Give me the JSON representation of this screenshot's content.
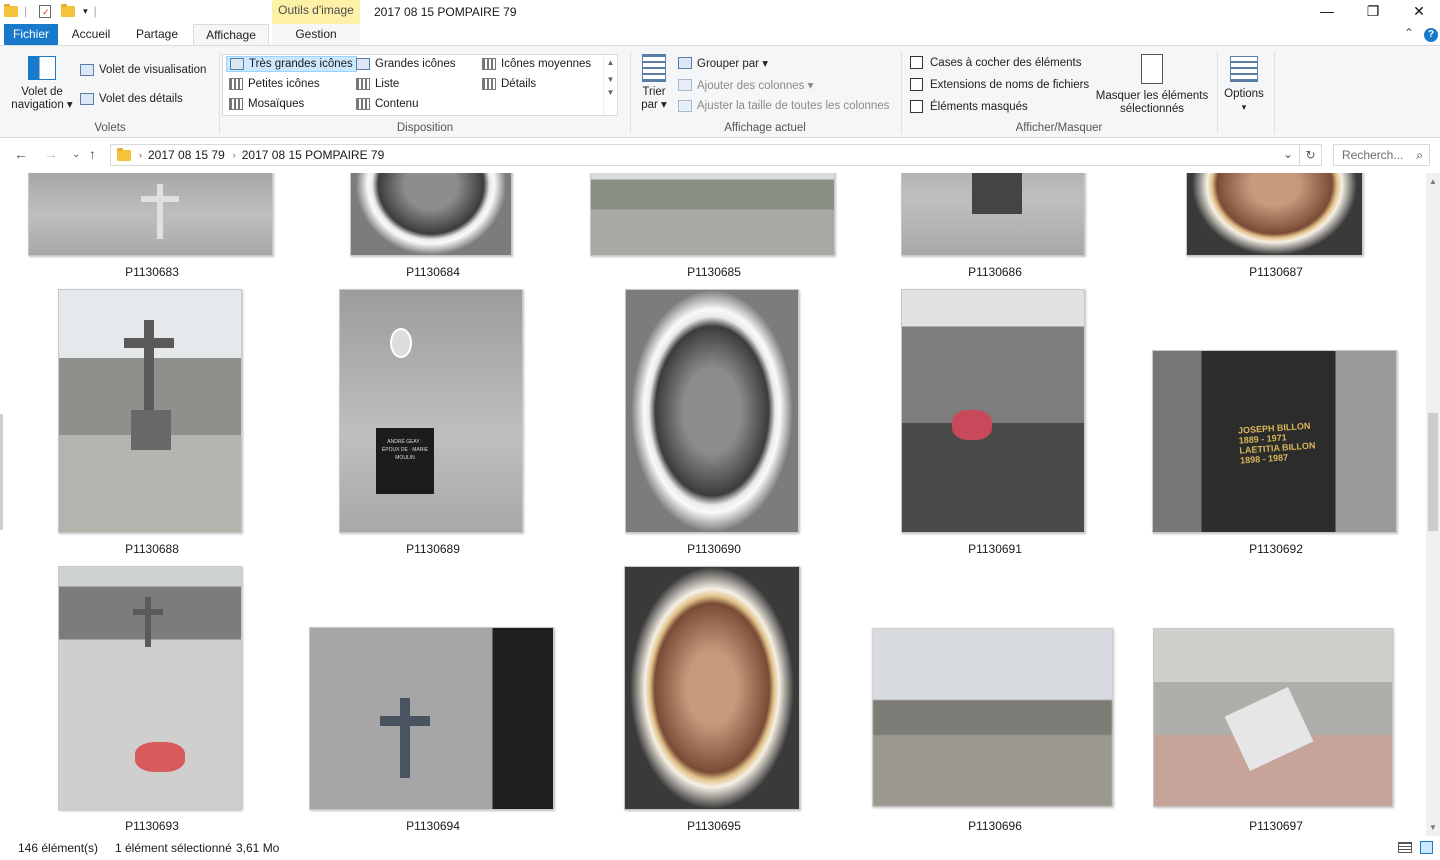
{
  "window": {
    "title": "2017 08 15 POMPAIRE 79",
    "contextual_tab_group": "Outils d'image",
    "minimize_glyph": "—",
    "maximize_glyph": "❐",
    "close_glyph": "✕"
  },
  "tabs": {
    "fichier": "Fichier",
    "accueil": "Accueil",
    "partage": "Partage",
    "affichage": "Affichage",
    "gestion": "Gestion",
    "collapse_glyph": "⌃",
    "help_glyph": "?"
  },
  "ribbon": {
    "volets": {
      "label": "Volets",
      "nav_pane": "Volet de navigation",
      "nav_pane_line1": "Volet de",
      "nav_pane_line2": "navigation ▾",
      "preview_pane": "Volet de visualisation",
      "details_pane": "Volet des détails"
    },
    "disposition": {
      "label": "Disposition",
      "items": [
        "Très grandes icônes",
        "Grandes icônes",
        "Icônes moyennes",
        "Petites icônes",
        "Liste",
        "Détails",
        "Mosaïques",
        "Contenu"
      ],
      "selected": "Très grandes icônes"
    },
    "affichage_actuel": {
      "label": "Affichage actuel",
      "sort_line1": "Trier",
      "sort_line2": "par ▾",
      "group_by": "Grouper par ▾",
      "add_columns": "Ajouter des colonnes ▾",
      "fit_columns": "Ajuster la taille de toutes les colonnes"
    },
    "afficher_masquer": {
      "label": "Afficher/Masquer",
      "checkbox_items": "Cases à cocher des éléments",
      "file_extensions": "Extensions de noms de fichiers",
      "hidden_items": "Éléments masqués",
      "hide_selected_line1": "Masquer les éléments",
      "hide_selected_line2": "sélectionnés"
    },
    "options": {
      "label": "Options",
      "arrow": "▾"
    }
  },
  "address": {
    "back_glyph": "←",
    "forward_glyph": "→",
    "recent_glyph": "⌄",
    "up_glyph": "↑",
    "crumbs": [
      "2017  08 15 79",
      "2017 08 15 POMPAIRE 79"
    ],
    "crumb_sep": "›",
    "dropdown_glyph": "⌄",
    "refresh_glyph": "↻",
    "search_placeholder": "Recherch...",
    "search_glyph": "⌕"
  },
  "files": {
    "row1": [
      "P1130683",
      "P1130684",
      "P1130685",
      "P1130686",
      "P1130687"
    ],
    "row2": [
      "P1130688",
      "P1130689",
      "P1130690",
      "P1130691",
      "P1130692"
    ],
    "row3": [
      "P1130693",
      "P1130694",
      "P1130695",
      "P1130696",
      "P1130697"
    ]
  },
  "photo_text": {
    "plaque_689": "ANDRÉ GEAY · ÉPOUX DE · MARIE MOULIN",
    "plaque_692_line1": "JOSEPH  BILLON",
    "plaque_692_line2": "1889 - 1971",
    "plaque_692_line3": "LAETITIA  BILLON",
    "plaque_692_line4": "1898 - 1987"
  },
  "status": {
    "count": "146 élément(s)",
    "selection": "1 élément sélectionné",
    "size": "3,61 Mo"
  },
  "colors": {
    "file_tab": "#1979ca",
    "contextual_tab": "#fdf1a7",
    "selection_fill": "#cce8ff"
  }
}
